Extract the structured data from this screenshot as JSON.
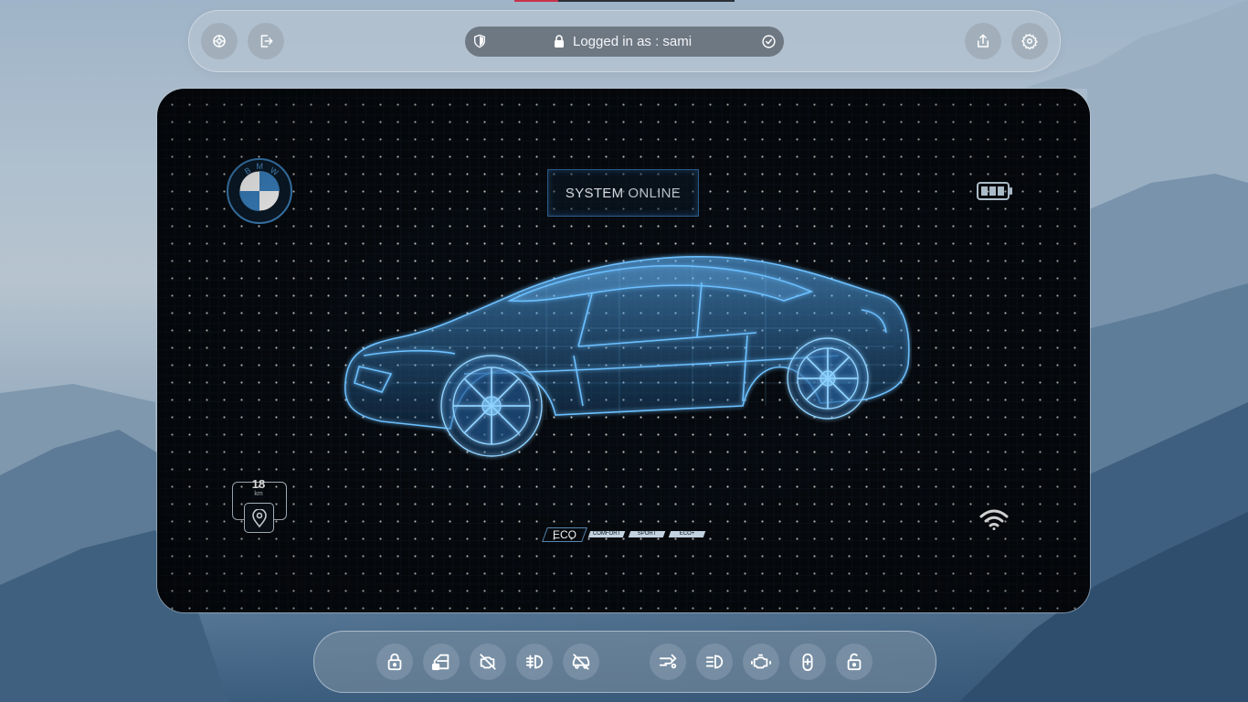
{
  "topbar": {
    "left_buttons": [
      {
        "icon": "scan-icon"
      },
      {
        "icon": "logout-icon"
      }
    ],
    "status": {
      "shield_icon": "shield-icon",
      "lock_icon": "lock-icon",
      "text": "Logged in as : sami",
      "check_icon": "check-circle-icon"
    },
    "right_buttons": [
      {
        "icon": "share-icon"
      },
      {
        "icon": "settings-icon"
      }
    ]
  },
  "dashboard": {
    "brand": "BMW",
    "system_status": {
      "word1": "SYSTEM",
      "word2": "ONLINE"
    },
    "battery_icon": "battery-icon",
    "distance": {
      "value": "18",
      "unit": "km"
    },
    "location_icon": "location-pin-icon",
    "wifi_icon": "wifi-icon",
    "drive_modes": [
      {
        "label": "ECO",
        "active": true
      },
      {
        "label": "COMFORT",
        "active": false
      },
      {
        "label": "SPORT",
        "active": false
      },
      {
        "label": "ECO+",
        "active": false
      }
    ]
  },
  "bottombar": {
    "controls": [
      "lock-icon",
      "door-lock-icon",
      "engine-off-icon",
      "fog-light-icon",
      "car-off-icon",
      "exhaust-icon",
      "headlight-icon",
      "engine-icon",
      "trunk-icon",
      "unlock-icon"
    ]
  },
  "colors": {
    "screen_bg": "#06090d",
    "accent_blue": "#4aa3e6",
    "topline_red": "#c8324a"
  }
}
